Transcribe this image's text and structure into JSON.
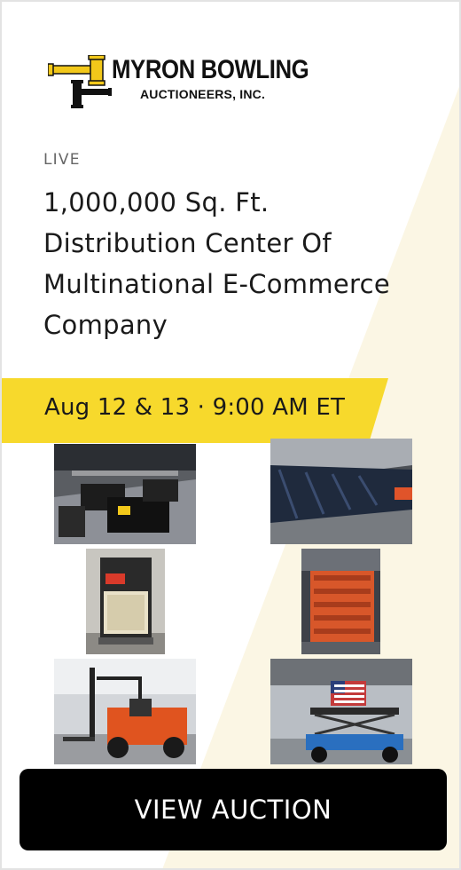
{
  "brand": {
    "name_line1": "MYRON BOWLING",
    "name_line2": "AUCTIONEERS, INC.",
    "logo_icon": "gavel-icon",
    "accent_color": "#f7d92c"
  },
  "auction": {
    "status": "LIVE",
    "title": "1,000,000 Sq. Ft. Distribution Center Of Multinational E-Commerce Company",
    "date": "Aug 12 & 13 · 9:00 AM ET"
  },
  "gallery": [
    {
      "subject": "warehouse workstations"
    },
    {
      "subject": "pallet racking beams"
    },
    {
      "subject": "air compressor"
    },
    {
      "subject": "orange steel racks"
    },
    {
      "subject": "forklift"
    },
    {
      "subject": "scissor lift"
    }
  ],
  "cta": {
    "label": "VIEW AUCTION"
  }
}
